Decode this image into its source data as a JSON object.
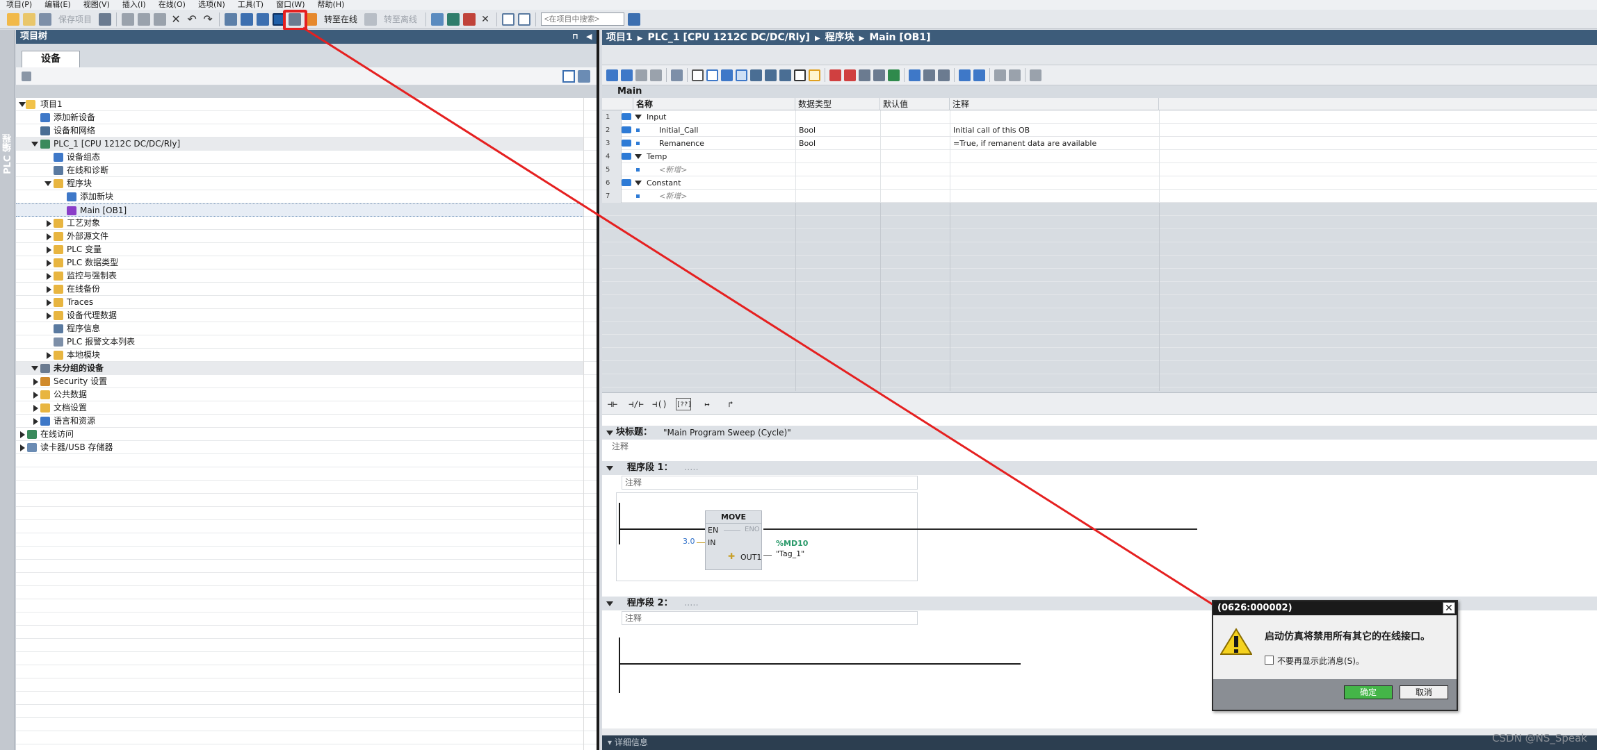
{
  "menu": [
    "项目(P)",
    "编辑(E)",
    "视图(V)",
    "插入(I)",
    "在线(O)",
    "选项(N)",
    "工具(T)",
    "窗口(W)",
    "帮助(H)"
  ],
  "toolbar": {
    "save_project": "保存项目",
    "go_online": "转至在线",
    "go_offline": "转至离线",
    "search_placeholder": "<在项目中搜索>"
  },
  "sidebar_tab": "PLC 编程",
  "project_tree": {
    "title": "项目树",
    "tab": "设备",
    "items": [
      {
        "label": "项目1"
      },
      {
        "label": "添加新设备"
      },
      {
        "label": "设备和网络"
      },
      {
        "label": "PLC_1 [CPU 1212C DC/DC/Rly]"
      },
      {
        "label": "设备组态"
      },
      {
        "label": "在线和诊断"
      },
      {
        "label": "程序块"
      },
      {
        "label": "添加新块"
      },
      {
        "label": "Main [OB1]"
      },
      {
        "label": "工艺对象"
      },
      {
        "label": "外部源文件"
      },
      {
        "label": "PLC 变量"
      },
      {
        "label": "PLC 数据类型"
      },
      {
        "label": "监控与强制表"
      },
      {
        "label": "在线备份"
      },
      {
        "label": "Traces"
      },
      {
        "label": "设备代理数据"
      },
      {
        "label": "程序信息"
      },
      {
        "label": "PLC 报警文本列表"
      },
      {
        "label": "本地模块"
      },
      {
        "label": "未分组的设备"
      },
      {
        "label": "Security 设置"
      },
      {
        "label": "公共数据"
      },
      {
        "label": "文档设置"
      },
      {
        "label": "语言和资源"
      },
      {
        "label": "在线访问"
      },
      {
        "label": "读卡器/USB 存储器"
      }
    ]
  },
  "breadcrumb": [
    "项目1",
    "PLC_1 [CPU 1212C DC/DC/Rly]",
    "程序块",
    "Main [OB1]"
  ],
  "block_name": "Main",
  "interface": {
    "columns": [
      "名称",
      "数据类型",
      "默认值",
      "注释"
    ],
    "rows": [
      {
        "num": "1",
        "name": "Input",
        "type": "",
        "comment": ""
      },
      {
        "num": "2",
        "name": "Initial_Call",
        "type": "Bool",
        "comment": "Initial call of this OB"
      },
      {
        "num": "3",
        "name": "Remanence",
        "type": "Bool",
        "comment": "=True, if remanent data are available"
      },
      {
        "num": "4",
        "name": "Temp",
        "type": "",
        "comment": ""
      },
      {
        "num": "5",
        "name": "<新增>",
        "type": "",
        "comment": ""
      },
      {
        "num": "6",
        "name": "Constant",
        "type": "",
        "comment": ""
      },
      {
        "num": "7",
        "name": "<新增>",
        "type": "",
        "comment": ""
      }
    ]
  },
  "ladder_tools": [
    "⊣⊢",
    "⊣/⊢",
    "⊣()",
    "[??]",
    "↦",
    "↱"
  ],
  "block_title": {
    "label": "块标题：",
    "value": "\"Main Program Sweep (Cycle)\"",
    "comment": "注释"
  },
  "network1": {
    "title": "程序段 1：",
    "dots": ".....",
    "comment": "注释",
    "box": "MOVE",
    "en": "EN",
    "eno": "ENO",
    "in_label": "IN",
    "in_value": "3.0",
    "out_label": "OUT1",
    "out_addr": "%MD10",
    "out_tag": "\"Tag_1\""
  },
  "network2": {
    "title": "程序段 2：",
    "dots": ".....",
    "comment": "注释"
  },
  "bottom_label": "▾ 详细信息",
  "dialog": {
    "title": "(0626:000002)",
    "message": "启动仿真将禁用所有其它的在线接口。",
    "checkbox": "不要再显示此消息(S)。",
    "ok": "确定",
    "cancel": "取消"
  },
  "watermark": "CSDN @NS_Speak",
  "colors": {
    "title_bar": "#3d5c7a",
    "highlight": "#e52020",
    "arrow": "#e52020",
    "ok_button": "#44b548"
  }
}
